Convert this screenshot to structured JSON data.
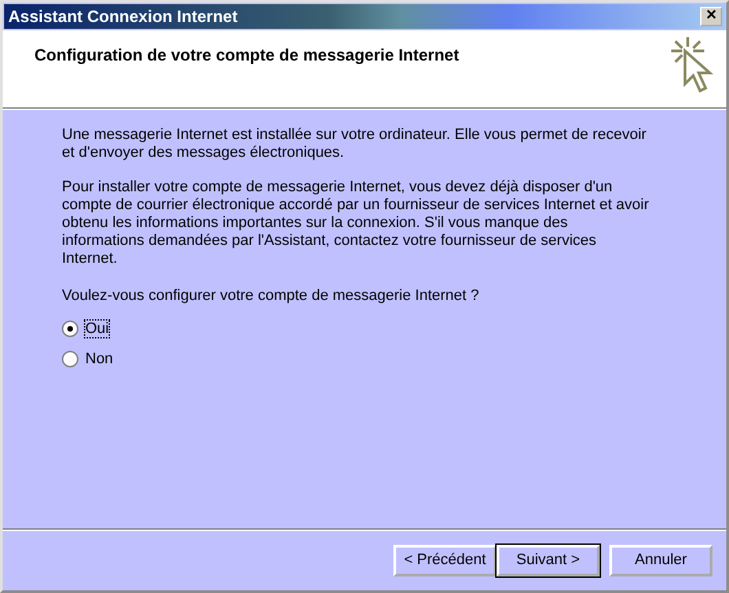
{
  "window": {
    "title": "Assistant Connexion Internet",
    "close_symbol": "✕"
  },
  "header": {
    "title": "Configuration de votre compte de messagerie Internet"
  },
  "paragraphs": [
    "Une messagerie Internet est installée sur votre ordinateur. Elle vous permet de recevoir et d'envoyer des messages électroniques.",
    "Pour installer votre compte de messagerie Internet, vous devez déjà disposer d'un compte de courrier électronique accordé par un fournisseur de services Internet et avoir obtenu les informations importantes sur la connexion. S'il vous manque des informations demandées par l'Assistant, contactez votre fournisseur de services Internet."
  ],
  "question": "Voulez-vous configurer votre compte de messagerie Internet ?",
  "options": [
    {
      "label": "Oui",
      "selected": true
    },
    {
      "label": "Non",
      "selected": false
    }
  ],
  "buttons": [
    {
      "label": "< Précédent",
      "default": false
    },
    {
      "label": "Suivant >",
      "default": true
    },
    {
      "label": "Annuler",
      "default": false
    }
  ]
}
